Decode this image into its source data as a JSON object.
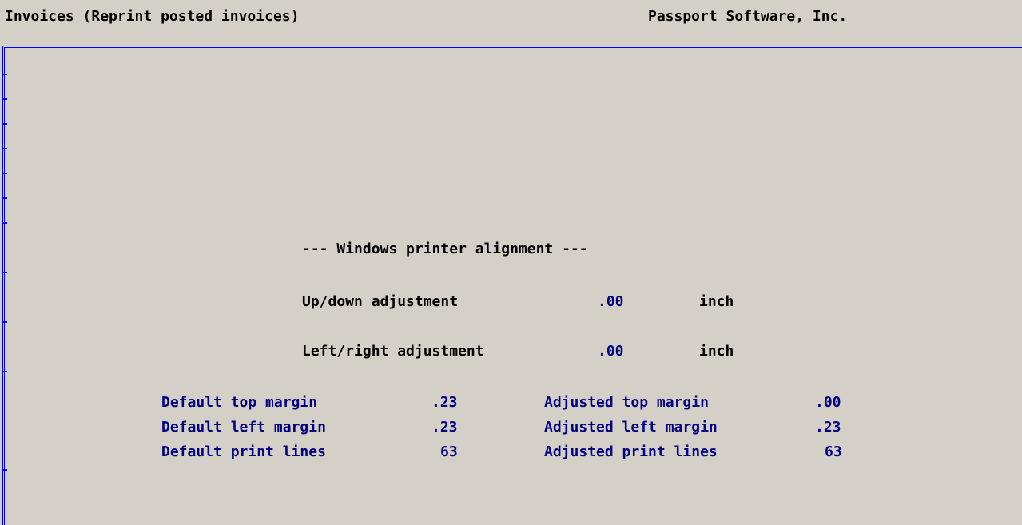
{
  "header": {
    "title": "Invoices (Reprint posted invoices)",
    "vendor": "Passport Software, Inc."
  },
  "alignment": {
    "heading": "--- Windows printer alignment ---",
    "updown": {
      "label": "Up/down adjustment",
      "value": ".00",
      "unit": "inch"
    },
    "leftright": {
      "label": "Left/right adjustment",
      "value": ".00",
      "unit": "inch"
    }
  },
  "defaults": [
    {
      "label": "Default top margin",
      "value": ".23"
    },
    {
      "label": "Default left margin",
      "value": ".23"
    },
    {
      "label": "Default print lines",
      "value": "63"
    }
  ],
  "adjusted": [
    {
      "label": "Adjusted top margin",
      "value": ".00"
    },
    {
      "label": "Adjusted left margin",
      "value": ".23"
    },
    {
      "label": "Adjusted print lines",
      "value": "63"
    }
  ],
  "colors": {
    "background": "#d4d0c8",
    "frame": "#0000ff",
    "field_text": "#000080"
  }
}
